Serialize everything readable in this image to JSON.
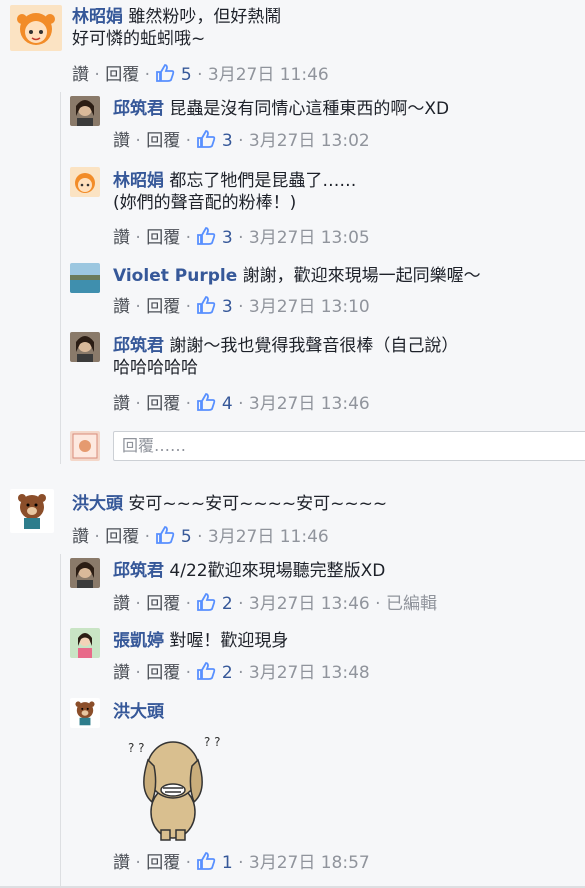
{
  "thread1": {
    "comment": {
      "author": "林昭娟",
      "line1": "雖然粉吵，但好熱鬧",
      "line2": "好可憐的蚯蚓哦~",
      "reply_label": "回覆",
      "like_label": "讚",
      "likes": "5",
      "time": "3月27日 11:46"
    },
    "replies": [
      {
        "author": "邱筑君",
        "line1": "昆蟲是沒有同情心這種東西的啊～XD",
        "like_label": "讚",
        "reply_label": "回覆",
        "likes": "3",
        "time": "3月27日 13:02"
      },
      {
        "author": "林昭娟",
        "line1": "都忘了牠們是昆蟲了……",
        "line2": "(妳們的聲音配的粉棒！)",
        "like_label": "讚",
        "reply_label": "回覆",
        "likes": "3",
        "time": "3月27日 13:05"
      },
      {
        "author": "Violet Purple",
        "line1": "謝謝，歡迎來現場一起同樂喔～",
        "like_label": "讚",
        "reply_label": "回覆",
        "likes": "3",
        "time": "3月27日 13:10"
      },
      {
        "author": "邱筑君",
        "line1": "謝謝～我也覺得我聲音很棒（自己說）",
        "line2": "哈哈哈哈哈",
        "like_label": "讚",
        "reply_label": "回覆",
        "likes": "4",
        "time": "3月27日 13:46"
      }
    ],
    "reply_placeholder": "回覆……"
  },
  "thread2": {
    "comment": {
      "author": "洪大頭",
      "line1": "安可~~~安可~~~~安可~~~~",
      "reply_label": "回覆",
      "like_label": "讚",
      "likes": "5",
      "time": "3月27日 11:46"
    },
    "replies": [
      {
        "author": "邱筑君",
        "line1": "4/22歡迎來現場聽完整版XD",
        "like_label": "讚",
        "reply_label": "回覆",
        "likes": "2",
        "time": "3月27日 13:46",
        "edited": "已編輯"
      },
      {
        "author": "張凱婷",
        "line1": "對喔！歡迎現身",
        "like_label": "讚",
        "reply_label": "回覆",
        "likes": "2",
        "time": "3月27日 13:48"
      },
      {
        "author": "洪大頭",
        "line1": "",
        "like_label": "讚",
        "reply_label": "回覆",
        "likes": "1",
        "time": "3月27日 18:57"
      }
    ]
  },
  "separator": "·",
  "colors": {
    "author": "#365899",
    "meta": "#90949c",
    "background": "#f6f7f9"
  },
  "icons": {
    "like": "thumbs-up-icon",
    "sticker": "bear-sticker"
  }
}
